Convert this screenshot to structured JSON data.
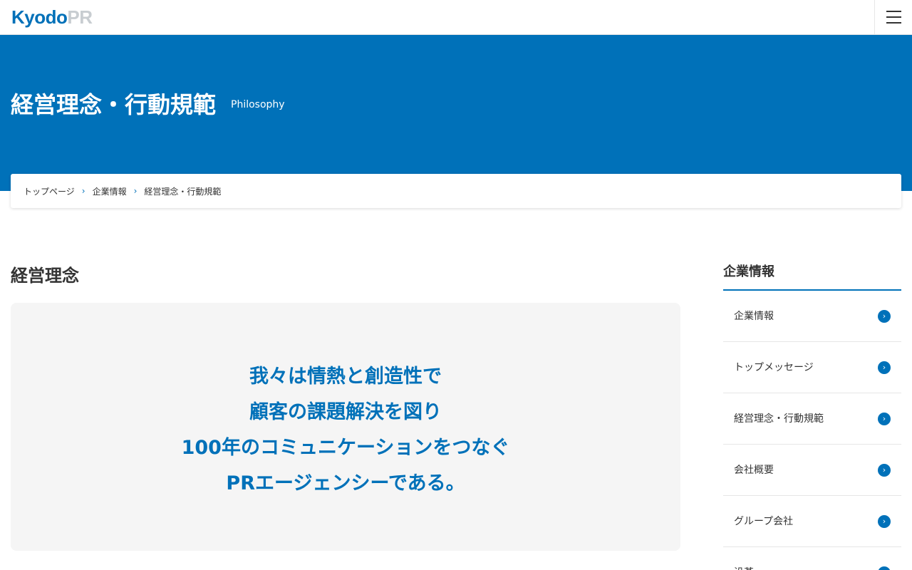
{
  "header": {
    "logo_part1": "Kyodo",
    "logo_part2": "PR",
    "menu_icon": "hamburger-menu-icon"
  },
  "hero": {
    "title": "経営理念・行動規範",
    "subtitle": "Philosophy",
    "background_color": "#0071b9"
  },
  "breadcrumb": {
    "items": [
      "トップページ",
      "企業情報",
      "経営理念・行動規範"
    ],
    "separator_icon": "chevron-right-icon"
  },
  "main": {
    "section_title": "経営理念",
    "philosophy_lines": [
      "我々は情熱と創造性で",
      "顧客の課題解決を図り",
      "100年のコミュニケーションをつなぐ",
      "PRエージェンシーである。"
    ]
  },
  "sidebar": {
    "title": "企業情報",
    "items": [
      {
        "label": "企業情報"
      },
      {
        "label": "トップメッセージ"
      },
      {
        "label": "経営理念・行動規範"
      },
      {
        "label": "会社概要"
      },
      {
        "label": "グループ会社"
      },
      {
        "label": "沿革"
      }
    ],
    "item_icon": "arrow-circle-right-icon"
  }
}
